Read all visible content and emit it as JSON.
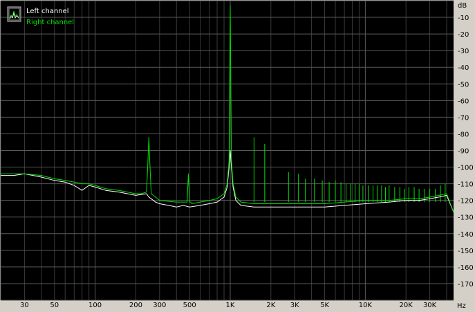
{
  "chart_data": {
    "type": "line",
    "x_scale": "log",
    "xlim": [
      20,
      45000
    ],
    "ylim": [
      -180,
      0
    ],
    "y_unit": "dB",
    "x_unit": "Hz",
    "x_ticks": [
      {
        "value": 30,
        "label": "30"
      },
      {
        "value": 50,
        "label": "50"
      },
      {
        "value": 100,
        "label": "100"
      },
      {
        "value": 200,
        "label": "200"
      },
      {
        "value": 300,
        "label": "300"
      },
      {
        "value": 500,
        "label": "500"
      },
      {
        "value": 1000,
        "label": "1K"
      },
      {
        "value": 2000,
        "label": "2K"
      },
      {
        "value": 3000,
        "label": "3K"
      },
      {
        "value": 5000,
        "label": "5K"
      },
      {
        "value": 10000,
        "label": "10K"
      },
      {
        "value": 20000,
        "label": "20K"
      },
      {
        "value": 30000,
        "label": "30K"
      }
    ],
    "y_ticks": [
      -10,
      -20,
      -30,
      -40,
      -50,
      -60,
      -70,
      -80,
      -90,
      -100,
      -110,
      -120,
      -130,
      -140,
      -150,
      -160,
      -170
    ],
    "grid": true,
    "legend_position": "top-left",
    "series": [
      {
        "name": "Left channel",
        "color": "#ffffff",
        "x": [
          20,
          25,
          30,
          40,
          50,
          60,
          70,
          80,
          90,
          100,
          120,
          150,
          200,
          240,
          250,
          260,
          280,
          300,
          350,
          400,
          450,
          500,
          600,
          700,
          800,
          900,
          950,
          980,
          1000,
          1020,
          1050,
          1100,
          1200,
          1500,
          2000,
          3000,
          5000,
          7000,
          10000,
          15000,
          20000,
          25000,
          30000,
          35000,
          40000,
          45000
        ],
        "y": [
          -105,
          -105,
          -104,
          -106,
          -108,
          -109,
          -111,
          -114,
          -111,
          -112,
          -114,
          -115,
          -117,
          -116,
          -118,
          -119,
          -121,
          -122,
          -123,
          -124,
          -123,
          -124,
          -123,
          -122,
          -121,
          -118,
          -112,
          -100,
          -90,
          -100,
          -112,
          -120,
          -123,
          -124,
          -124,
          -124,
          -124,
          -123,
          -122,
          -121,
          -120,
          -120,
          -119,
          -118,
          -117,
          -127
        ]
      },
      {
        "name": "Right channel",
        "color": "#00e000",
        "x": [
          20,
          25,
          30,
          40,
          50,
          60,
          70,
          80,
          90,
          100,
          120,
          150,
          200,
          220,
          240,
          245,
          250,
          255,
          260,
          280,
          300,
          400,
          480,
          490,
          500,
          510,
          520,
          600,
          700,
          800,
          900,
          950,
          980,
          1000,
          1020,
          1050,
          1100,
          1200,
          1500,
          2000,
          3000,
          5000,
          7000,
          10000,
          15000,
          20000,
          25000,
          30000,
          35000,
          40000,
          45000
        ],
        "y": [
          -104,
          -104,
          -104,
          -105,
          -107,
          -108,
          -109,
          -110,
          -110,
          -111,
          -113,
          -114,
          -116,
          -116,
          -115,
          -100,
          -82,
          -100,
          -116,
          -118,
          -120,
          -121,
          -121,
          -104,
          -121,
          -121,
          -122,
          -121,
          -120,
          -119,
          -116,
          -110,
          -96,
          -3,
          -96,
          -110,
          -118,
          -121,
          -122,
          -122,
          -122,
          -122,
          -121,
          -120,
          -120,
          -119,
          -119,
          -118,
          -117,
          -116,
          -127
        ]
      }
    ],
    "spurs": [
      {
        "freq": 1500,
        "level": -82
      },
      {
        "freq": 1800,
        "level": -86
      },
      {
        "freq": 2700,
        "level": -103
      },
      {
        "freq": 3200,
        "level": -104
      },
      {
        "freq": 3600,
        "level": -107
      },
      {
        "freq": 4200,
        "level": -107
      },
      {
        "freq": 4800,
        "level": -108
      },
      {
        "freq": 5400,
        "level": -109
      },
      {
        "freq": 6000,
        "level": -108
      },
      {
        "freq": 6600,
        "level": -109
      },
      {
        "freq": 7200,
        "level": -110
      },
      {
        "freq": 7800,
        "level": -110
      },
      {
        "freq": 8400,
        "level": -110
      },
      {
        "freq": 9000,
        "level": -110
      },
      {
        "freq": 9600,
        "level": -111
      },
      {
        "freq": 10500,
        "level": -111
      },
      {
        "freq": 11400,
        "level": -111
      },
      {
        "freq": 12300,
        "level": -111
      },
      {
        "freq": 13200,
        "level": -111
      },
      {
        "freq": 14100,
        "level": -112
      },
      {
        "freq": 15000,
        "level": -111
      },
      {
        "freq": 16500,
        "level": -112
      },
      {
        "freq": 18000,
        "level": -112
      },
      {
        "freq": 19500,
        "level": -113
      },
      {
        "freq": 21000,
        "level": -112
      },
      {
        "freq": 23000,
        "level": -112
      },
      {
        "freq": 25000,
        "level": -113
      },
      {
        "freq": 27500,
        "level": -113
      },
      {
        "freq": 30000,
        "level": -113
      },
      {
        "freq": 33000,
        "level": -113
      },
      {
        "freq": 36000,
        "level": -111
      },
      {
        "freq": 39000,
        "level": -110
      }
    ]
  },
  "legend": {
    "items": [
      {
        "label": "Left channel",
        "color": "#ffffff"
      },
      {
        "label": "Right channel",
        "color": "#00e000"
      }
    ]
  },
  "axis": {
    "y_unit_label": "dB",
    "x_unit_label": "Hz"
  },
  "colors": {
    "plot_background": "#000000",
    "frame_background": "#d4d0c8",
    "grid_major": "#5a5a5a",
    "grid_minor": "#3a3a3a"
  }
}
